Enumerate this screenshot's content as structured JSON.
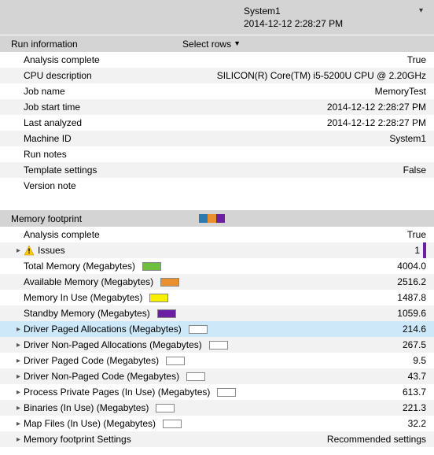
{
  "header": {
    "system": "System1",
    "timestamp": "2014-12-12 2:28:27 PM"
  },
  "runinfo": {
    "title": "Run information",
    "select_rows": "Select rows",
    "rows": [
      {
        "label": "Analysis complete",
        "value": "True"
      },
      {
        "label": "CPU description",
        "value": "SILICON(R) Core(TM) i5-5200U CPU @ 2.20GHz"
      },
      {
        "label": "Job name",
        "value": "MemoryTest"
      },
      {
        "label": "Job start time",
        "value": "2014-12-12 2:28:27 PM"
      },
      {
        "label": "Last analyzed",
        "value": "2014-12-12 2:28:27 PM"
      },
      {
        "label": "Machine ID",
        "value": "System1"
      },
      {
        "label": "Run notes",
        "value": ""
      },
      {
        "label": "Template settings",
        "value": "False"
      },
      {
        "label": "Version note",
        "value": ""
      }
    ]
  },
  "memfoot": {
    "title": "Memory footprint",
    "header_swatches": [
      "#2a7ab0",
      "#e98f2e",
      "#6b1fa3"
    ],
    "rows": [
      {
        "label": "Analysis complete",
        "value": "True",
        "expandable": false
      },
      {
        "label": "Issues",
        "value": "1",
        "expandable": true,
        "icon": "warn",
        "accent": true
      },
      {
        "label": "Total Memory (Megabytes)",
        "value": "4004.0",
        "swatch": "#6fbf3f"
      },
      {
        "label": "Available Memory (Megabytes)",
        "value": "2516.2",
        "swatch": "#e98f2e"
      },
      {
        "label": "Memory In Use (Megabytes)",
        "value": "1487.8",
        "swatch": "#f7f100"
      },
      {
        "label": "Standby Memory (Megabytes)",
        "value": "1059.6",
        "swatch": "#6b1fa3"
      },
      {
        "label": "Driver Paged Allocations (Megabytes)",
        "value": "214.6",
        "expandable": true,
        "swatch": "empty",
        "selected": true
      },
      {
        "label": "Driver Non-Paged Allocations (Megabytes)",
        "value": "267.5",
        "expandable": true,
        "swatch": "empty"
      },
      {
        "label": "Driver Paged Code (Megabytes)",
        "value": "9.5",
        "expandable": true,
        "swatch": "empty"
      },
      {
        "label": "Driver Non-Paged Code (Megabytes)",
        "value": "43.7",
        "expandable": true,
        "swatch": "empty"
      },
      {
        "label": "Process Private Pages (In Use) (Megabytes)",
        "value": "613.7",
        "expandable": true,
        "swatch": "empty"
      },
      {
        "label": "Binaries (In Use) (Megabytes)",
        "value": "221.3",
        "expandable": true,
        "swatch": "empty"
      },
      {
        "label": "Map Files (In Use) (Megabytes)",
        "value": "32.2",
        "expandable": true,
        "swatch": "empty"
      },
      {
        "label": "Memory footprint Settings",
        "value": "Recommended settings",
        "expandable": true
      }
    ]
  }
}
